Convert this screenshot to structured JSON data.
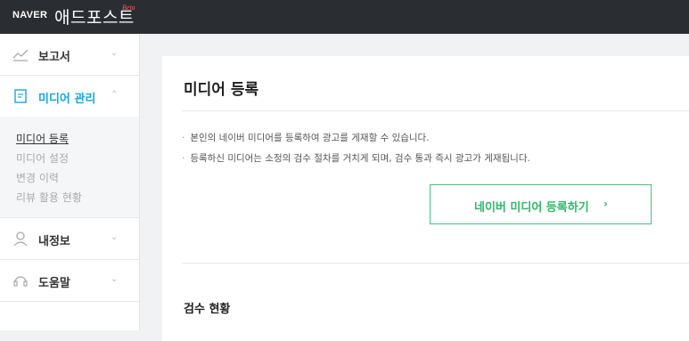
{
  "header": {
    "brand": "NAVER",
    "service": "애드포스트",
    "beta": "Beta"
  },
  "sidebar": {
    "items": [
      {
        "label": "보고서",
        "icon": "chart-line-icon"
      },
      {
        "label": "미디어 관리",
        "icon": "document-icon"
      },
      {
        "label": "내정보",
        "icon": "user-icon"
      },
      {
        "label": "도움말",
        "icon": "headset-icon"
      }
    ],
    "submenu": [
      "미디어 등록",
      "미디어 설정",
      "변경 이력",
      "리뷰 활용 현황"
    ]
  },
  "main": {
    "title": "미디어 등록",
    "bullets": [
      "본인의 네이버 미디어를 등록하여 광고를 게재할 수 있습니다.",
      "등록하신 미디어는 소정의 검수 절차를 거치게 되며, 검수 통과 즉시 광고가 게재됩니다."
    ],
    "register_button": "네이버 미디어 등록하기",
    "register_arrow": "›",
    "section_title": "검수 현황"
  },
  "colors": {
    "topbar": "#2a2d32",
    "accent": "#15a7e0",
    "green": "#2db968",
    "beta": "#ff5b5b"
  }
}
